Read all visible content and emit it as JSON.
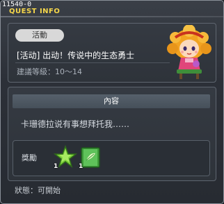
{
  "debug_id": "11540-0",
  "window": {
    "title": "QUEST INFO"
  },
  "quest": {
    "tag": "活動",
    "name": "[活动] 出动！传说中的生态勇士",
    "level": "建議等級：10～14"
  },
  "content": {
    "header": "內容",
    "description": "卡珊德拉说有事想拜托我……"
  },
  "rewards": {
    "label": "獎勵",
    "items": [
      {
        "icon": "green-star-icon",
        "qty": "1"
      },
      {
        "icon": "green-book-icon",
        "qty": "1"
      }
    ]
  },
  "status": "狀態：可開始",
  "colors": {
    "title": "#f6d74a",
    "badge": "#d8d8d8",
    "header": "#56606b"
  }
}
